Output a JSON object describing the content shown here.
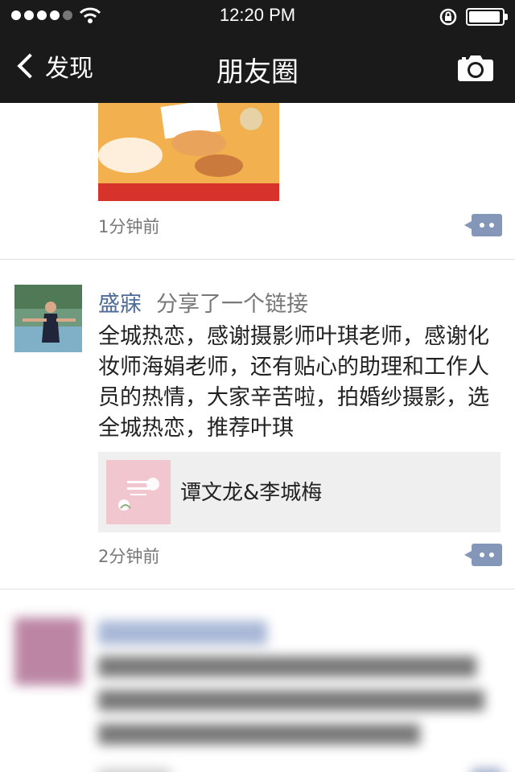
{
  "status_bar": {
    "time": "12:20 PM",
    "signal_dots": 5,
    "signal_strength": 4,
    "icons": [
      "wifi-icon",
      "rotation-lock-icon",
      "battery-icon"
    ]
  },
  "nav": {
    "back_label": "发现",
    "title": "朋友圈",
    "right_icon": "camera-icon"
  },
  "feed": {
    "previous_post": {
      "time": "1分钟前"
    },
    "post": {
      "author": "盛寐",
      "action": "分享了一个链接",
      "text": "全城热恋，感谢摄影师叶琪老师，感谢化妆师海娟老师，还有贴心的助理和工作人员的热情，大家辛苦啦，拍婚纱摄影，选全城热恋，推荐叶琪",
      "link": {
        "title": "谭文龙&李城梅",
        "thumb_icon": "wedding-brand-thumbnail"
      },
      "time": "2分钟前"
    }
  },
  "colors": {
    "nav_bg": "#1a1a1a",
    "author_link": "#4e6b99",
    "comment_button": "#8597b9",
    "link_card_bg": "#efefef"
  }
}
